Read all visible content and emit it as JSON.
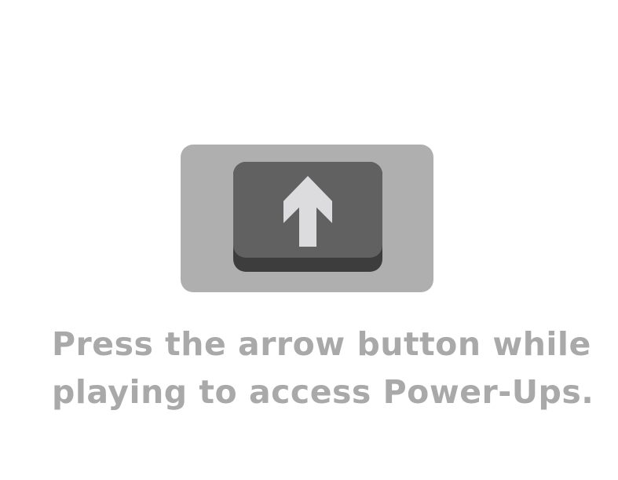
{
  "powerup_key": {
    "icon": "arrow-up-icon",
    "colors": {
      "panel": "#afafaf",
      "key_face": "#616161",
      "key_side": "#3d3d3d",
      "arrow": "#dcdcdf",
      "text": "#a9a9a9"
    }
  },
  "instruction": {
    "line1": "Press the arrow button while",
    "line2": "playing to access Power-Ups."
  }
}
